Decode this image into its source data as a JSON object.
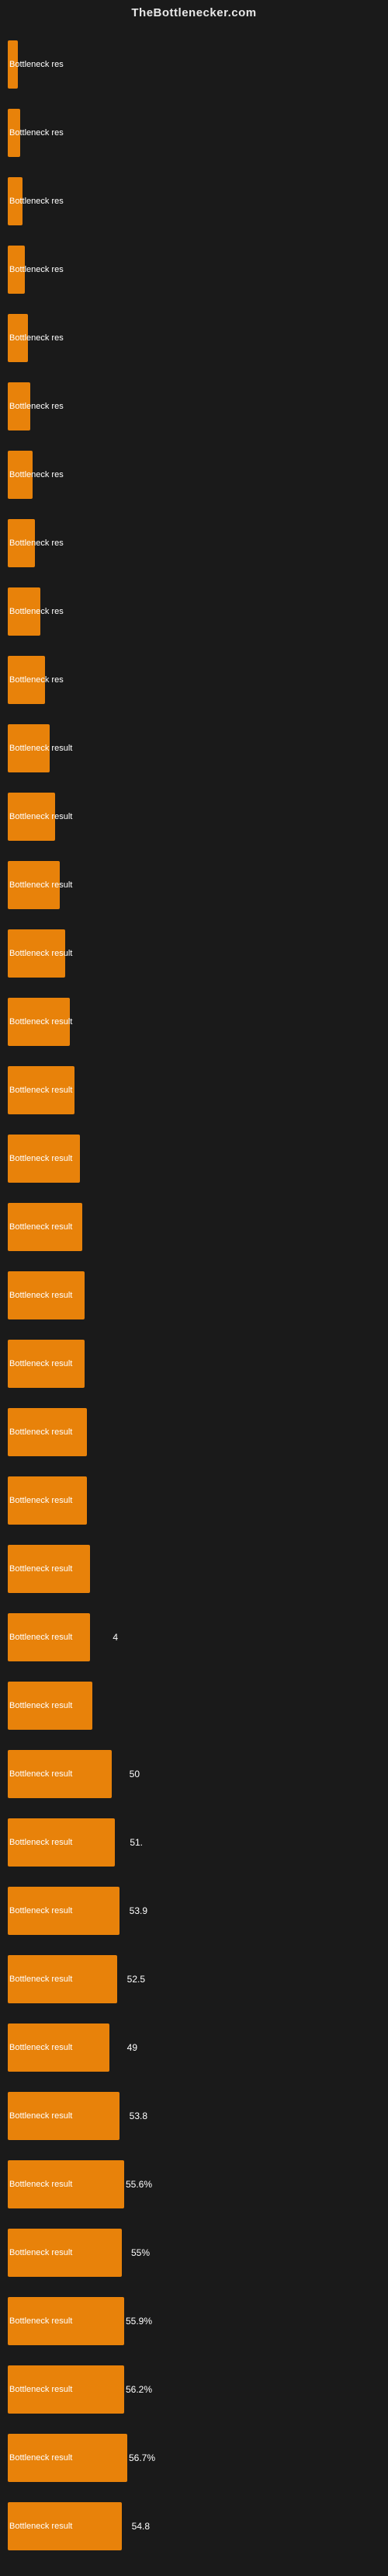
{
  "header": {
    "title": "TheBottlenecker.com"
  },
  "chart": {
    "label": "Bottleneck result",
    "bars": [
      {
        "id": 1,
        "label": "Bottleneck res",
        "value": null,
        "width_pct": 4
      },
      {
        "id": 2,
        "label": "Bottleneck res",
        "value": null,
        "width_pct": 5
      },
      {
        "id": 3,
        "label": "Bottleneck res",
        "value": null,
        "width_pct": 6
      },
      {
        "id": 4,
        "label": "Bottleneck res",
        "value": null,
        "width_pct": 7
      },
      {
        "id": 5,
        "label": "Bottleneck res",
        "value": null,
        "width_pct": 8
      },
      {
        "id": 6,
        "label": "Bottleneck res",
        "value": null,
        "width_pct": 9
      },
      {
        "id": 7,
        "label": "Bottleneck res",
        "value": null,
        "width_pct": 10
      },
      {
        "id": 8,
        "label": "Bottleneck res",
        "value": null,
        "width_pct": 11
      },
      {
        "id": 9,
        "label": "Bottleneck res",
        "value": null,
        "width_pct": 13
      },
      {
        "id": 10,
        "label": "Bottleneck res",
        "value": null,
        "width_pct": 15
      },
      {
        "id": 11,
        "label": "Bottleneck result",
        "value": null,
        "width_pct": 17
      },
      {
        "id": 12,
        "label": "Bottleneck result",
        "value": null,
        "width_pct": 19
      },
      {
        "id": 13,
        "label": "Bottleneck result",
        "value": null,
        "width_pct": 21
      },
      {
        "id": 14,
        "label": "Bottleneck result",
        "value": null,
        "width_pct": 23
      },
      {
        "id": 15,
        "label": "Bottleneck result",
        "value": null,
        "width_pct": 25
      },
      {
        "id": 16,
        "label": "Bottleneck result",
        "value": null,
        "width_pct": 27
      },
      {
        "id": 17,
        "label": "Bottleneck result",
        "value": null,
        "width_pct": 29
      },
      {
        "id": 18,
        "label": "Bottleneck result",
        "value": null,
        "width_pct": 30
      },
      {
        "id": 19,
        "label": "Bottleneck result",
        "value": null,
        "width_pct": 31
      },
      {
        "id": 20,
        "label": "Bottleneck result",
        "value": null,
        "width_pct": 31
      },
      {
        "id": 21,
        "label": "Bottleneck result",
        "value": null,
        "width_pct": 32
      },
      {
        "id": 22,
        "label": "Bottleneck result",
        "value": null,
        "width_pct": 32
      },
      {
        "id": 23,
        "label": "Bottleneck result",
        "value": null,
        "width_pct": 33
      },
      {
        "id": 24,
        "label": "Bottleneck result",
        "value": "4",
        "width_pct": 33
      },
      {
        "id": 25,
        "label": "Bottleneck result",
        "value": null,
        "width_pct": 34
      },
      {
        "id": 26,
        "label": "Bottleneck result",
        "value": "50",
        "width_pct": 42
      },
      {
        "id": 27,
        "label": "Bottleneck result",
        "value": "51.",
        "width_pct": 43
      },
      {
        "id": 28,
        "label": "Bottleneck result",
        "value": "53.9",
        "width_pct": 45
      },
      {
        "id": 29,
        "label": "Bottleneck result",
        "value": "52.5",
        "width_pct": 44
      },
      {
        "id": 30,
        "label": "Bottleneck result",
        "value": "49",
        "width_pct": 41
      },
      {
        "id": 31,
        "label": "Bottleneck result",
        "value": "53.8",
        "width_pct": 45
      },
      {
        "id": 32,
        "label": "Bottleneck result",
        "value": "55.6%",
        "width_pct": 47
      },
      {
        "id": 33,
        "label": "Bottleneck result",
        "value": "55%",
        "width_pct": 46
      },
      {
        "id": 34,
        "label": "Bottleneck result",
        "value": "55.9%",
        "width_pct": 47
      },
      {
        "id": 35,
        "label": "Bottleneck result",
        "value": "56.2%",
        "width_pct": 47
      },
      {
        "id": 36,
        "label": "Bottleneck result",
        "value": "56.7%",
        "width_pct": 48
      },
      {
        "id": 37,
        "label": "Bottleneck result",
        "value": "54.8",
        "width_pct": 46
      }
    ]
  }
}
